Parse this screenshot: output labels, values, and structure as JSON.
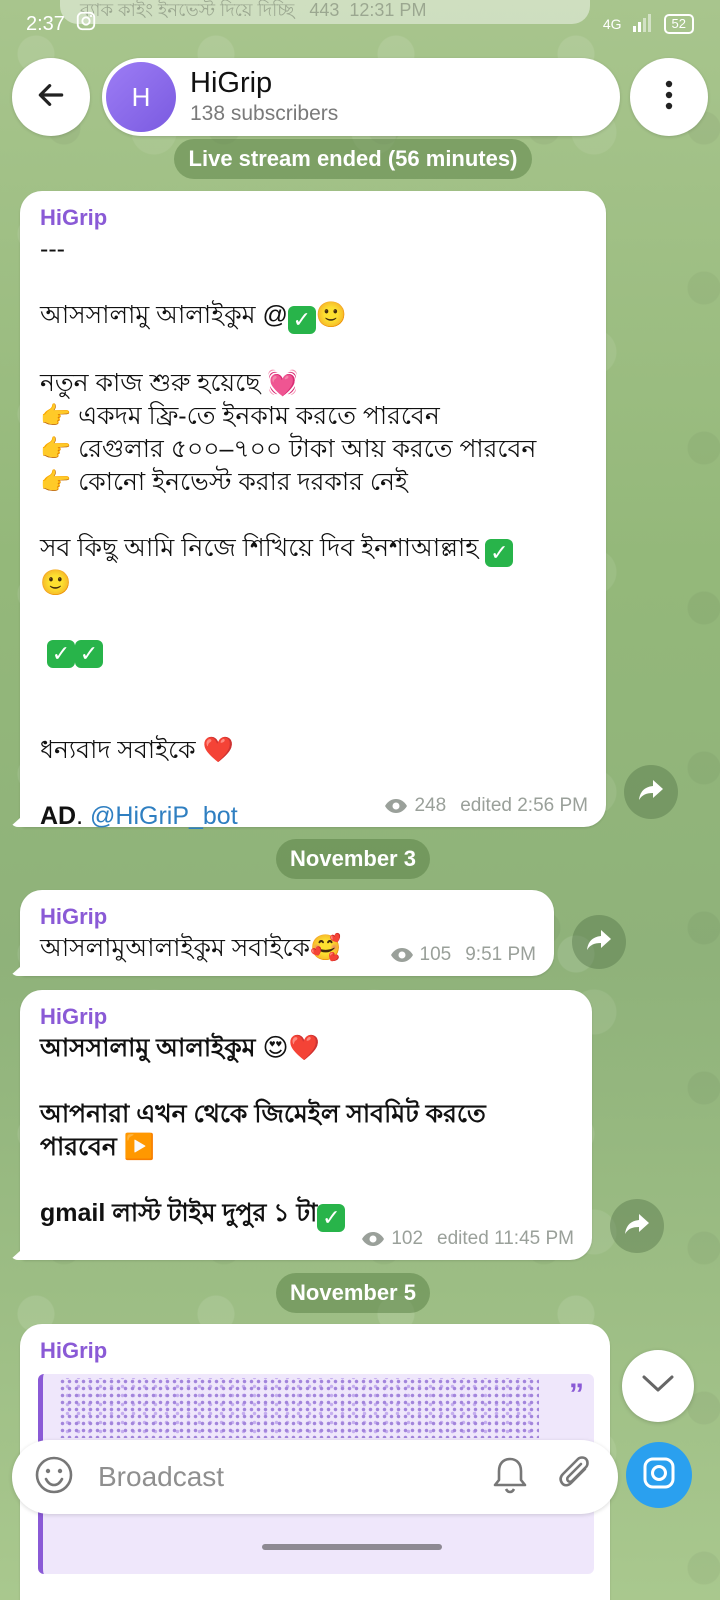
{
  "status_bar": {
    "time": "2:37",
    "network": "4G",
    "battery": "52"
  },
  "prev_message": {
    "text": "ব্যাক কাইং ইনভেস্ট দিয়ে দিচ্ছি",
    "views": "443",
    "time": "12:31 PM"
  },
  "header": {
    "avatar_letter": "H",
    "title": "HiGrip",
    "subtitle": "138 subscribers"
  },
  "service_live": "Live stream ended (56 minutes)",
  "messages": [
    {
      "sender": "HiGrip",
      "lines": [
        "---",
        "",
        "আসসালামু আলাইকুম @",
        "",
        "নতুন কাজ শুরু হয়েছে 💓",
        "👉 একদম ফ্রি-তে ইনকাম করতে পারবেন",
        "👉 রেগুলার ৫০০–৭০০ টাকা আয় করতে পারবেন",
        "👉 কোনো ইনভেস্ট করার দরকার নেই",
        "",
        "সব কিছু আমি নিজে শিখিয়ে দিব ইনশাআল্লাহ",
        "🙂",
        "",
        "",
        "",
        "",
        "ধন্যবাদ সবাইকে ❤️",
        ""
      ],
      "ad_label": "AD",
      "ad_link": "@HiGriP_bot",
      "views": "248",
      "time": "edited 2:56 PM"
    },
    {
      "sender": "HiGrip",
      "text": "আসলামুআলাইকুম সবাইকে🥰",
      "views": "105",
      "time": "9:51 PM"
    },
    {
      "sender": "HiGrip",
      "lines": [
        "আসসালামু আলাইকুম 😍❤️",
        "",
        "আপনারা এখন থেকে জিমেইল সাবমিট করতে",
        "পারবেন ▶️",
        "",
        "gmail লাস্ট টাইম দুপুর ১ টা"
      ],
      "views": "102",
      "time": "edited 11:45 PM"
    },
    {
      "sender": "HiGrip"
    }
  ],
  "date_nov3": "November 3",
  "date_nov5": "November 5",
  "input": {
    "placeholder": "Broadcast"
  },
  "colors": {
    "accent": "#8a5ad6",
    "link": "#2f7fc1",
    "camera": "#2aa0ef",
    "check": "#28b44a"
  }
}
